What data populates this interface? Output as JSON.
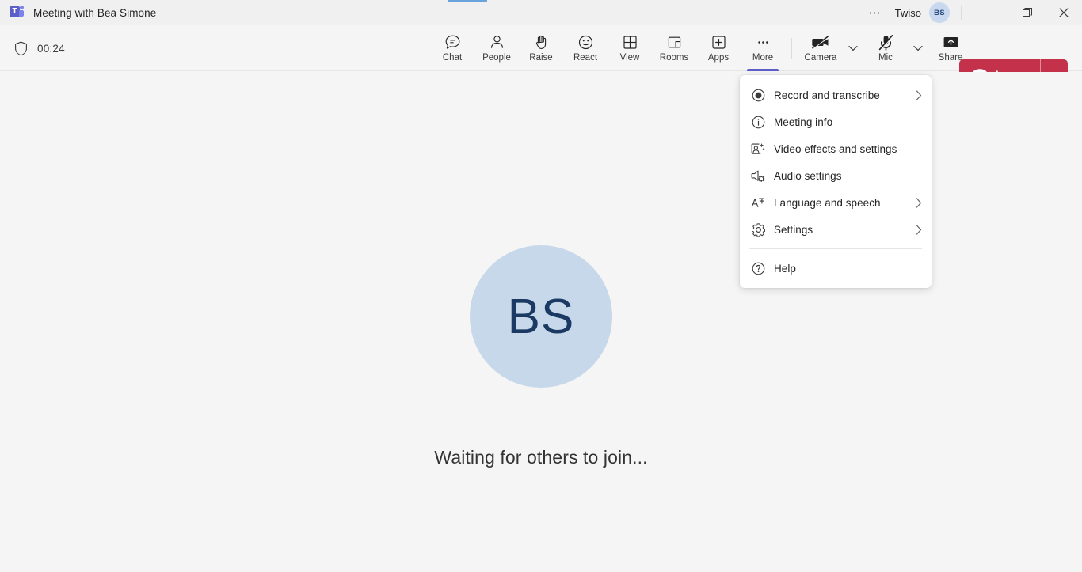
{
  "window": {
    "title": "Meeting with Bea Simone",
    "logo_icon": "teams-logo-icon",
    "logo_letter": "T",
    "overflow_icon": "more-horizontal-icon",
    "account_name": "Twiso",
    "account_initials": "BS",
    "minimize_icon": "minimize-icon",
    "restore_icon": "restore-icon",
    "close_icon": "close-icon"
  },
  "toolbar": {
    "shield_icon": "shield-icon",
    "timer": "00:24",
    "buttons": [
      {
        "label": "Chat",
        "icon": "chat-icon",
        "active": false
      },
      {
        "label": "People",
        "icon": "people-icon",
        "active": false
      },
      {
        "label": "Raise",
        "icon": "raise-hand-icon",
        "active": false
      },
      {
        "label": "React",
        "icon": "react-smiley-icon",
        "active": false
      },
      {
        "label": "View",
        "icon": "view-grid-icon",
        "active": false
      },
      {
        "label": "Rooms",
        "icon": "breakout-rooms-icon",
        "active": false
      },
      {
        "label": "Apps",
        "icon": "apps-plus-icon",
        "active": false
      },
      {
        "label": "More",
        "icon": "more-horizontal-icon",
        "active": true
      }
    ],
    "camera": {
      "label": "Camera",
      "icon": "camera-off-icon",
      "muted": true,
      "caret_icon": "chevron-down-icon"
    },
    "mic": {
      "label": "Mic",
      "icon": "mic-off-icon",
      "muted": true,
      "caret_icon": "chevron-down-icon"
    },
    "share": {
      "label": "Share",
      "icon": "share-screen-icon"
    },
    "leave": {
      "label": "Leave",
      "icon": "hangup-phone-icon",
      "caret_icon": "chevron-down-icon",
      "color": "#c4314b"
    }
  },
  "stage": {
    "avatar_initials": "BS",
    "avatar_bg": "#c7d8ea",
    "avatar_fg": "#1b3a63",
    "status_text": "Waiting for others to join..."
  },
  "more_menu": {
    "items": [
      {
        "label": "Record and transcribe",
        "icon": "record-circle-icon",
        "submenu": true
      },
      {
        "label": "Meeting info",
        "icon": "info-circle-icon",
        "submenu": false
      },
      {
        "label": "Video effects and settings",
        "icon": "video-effects-icon",
        "submenu": false
      },
      {
        "label": "Audio settings",
        "icon": "audio-settings-icon",
        "submenu": false
      },
      {
        "label": "Language and speech",
        "icon": "language-icon",
        "submenu": true
      },
      {
        "label": "Settings",
        "icon": "gear-icon",
        "submenu": true
      }
    ],
    "footer_items": [
      {
        "label": "Help",
        "icon": "help-circle-icon",
        "submenu": false
      }
    ]
  },
  "colors": {
    "accent_purple": "#5b5fc7",
    "tab_blue": "#6ba4dc",
    "leave_red": "#c4314b",
    "stage_bg": "#f5f5f5"
  }
}
